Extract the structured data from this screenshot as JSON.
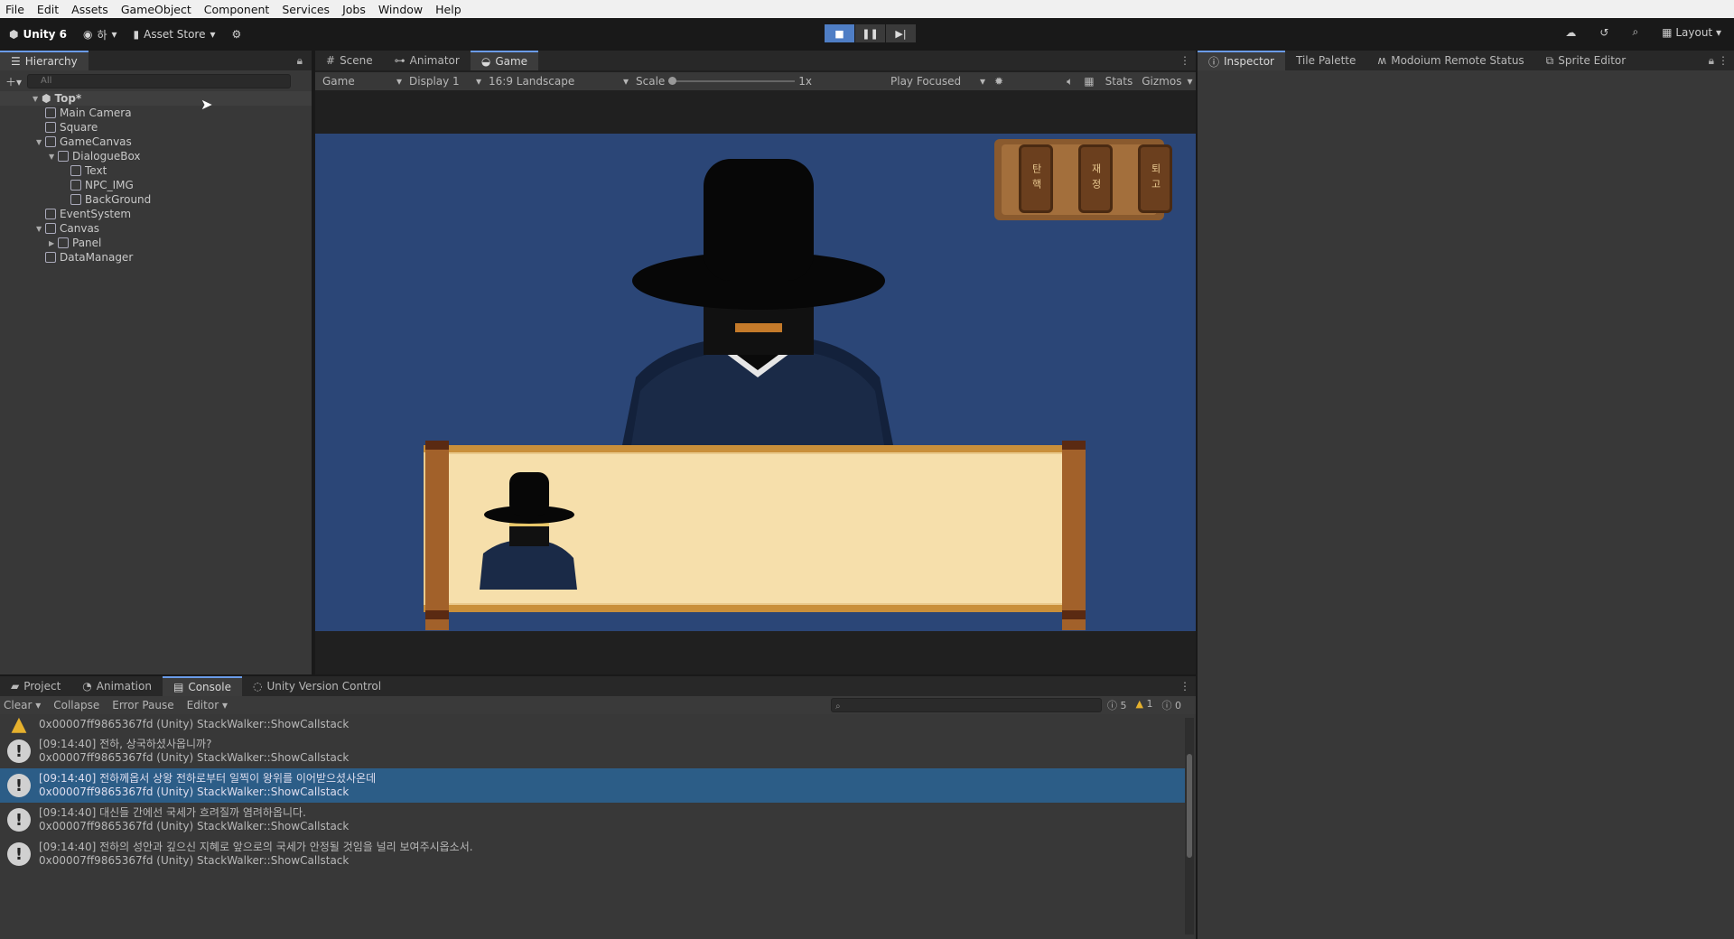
{
  "menu": [
    "File",
    "Edit",
    "Assets",
    "GameObject",
    "Component",
    "Services",
    "Jobs",
    "Window",
    "Help"
  ],
  "toolbar": {
    "unity_label": "Unity 6",
    "account_label": "하",
    "asset_store_label": "Asset Store",
    "layout_label": "Layout"
  },
  "hierarchy": {
    "tab_label": "Hierarchy",
    "search_placeholder": "All",
    "scene": "Top*",
    "items": [
      {
        "label": "Main Camera",
        "depth": 1,
        "expand": ""
      },
      {
        "label": "Square",
        "depth": 1,
        "expand": ""
      },
      {
        "label": "GameCanvas",
        "depth": 1,
        "expand": "▼"
      },
      {
        "label": "DialogueBox",
        "depth": 2,
        "expand": "▼"
      },
      {
        "label": "Text",
        "depth": 3,
        "expand": ""
      },
      {
        "label": "NPC_IMG",
        "depth": 3,
        "expand": ""
      },
      {
        "label": "BackGround",
        "depth": 3,
        "expand": ""
      },
      {
        "label": "EventSystem",
        "depth": 1,
        "expand": ""
      },
      {
        "label": "Canvas",
        "depth": 1,
        "expand": "▼"
      },
      {
        "label": "Panel",
        "depth": 2,
        "expand": "▶"
      },
      {
        "label": "DataManager",
        "depth": 1,
        "expand": ""
      }
    ]
  },
  "center_tabs": {
    "scene": "Scene",
    "animator": "Animator",
    "game": "Game"
  },
  "game_toolbar": {
    "mode": "Game",
    "display": "Display 1",
    "aspect": "16:9 Landscape",
    "scale_label": "Scale",
    "scale_value": "1x",
    "play_mode": "Play Focused",
    "stats": "Stats",
    "gizmos": "Gizmos"
  },
  "game_view": {
    "buttons": [
      "탄핵",
      "재정",
      "퇴고"
    ]
  },
  "right_tabs": {
    "inspector": "Inspector",
    "tile_palette": "Tile Palette",
    "modoium": "Modoium Remote Status",
    "sprite_editor": "Sprite Editor"
  },
  "bottom_tabs": {
    "project": "Project",
    "animation": "Animation",
    "console": "Console",
    "uvc": "Unity Version Control"
  },
  "console_toolbar": {
    "clear": "Clear",
    "collapse": "Collapse",
    "error_pause": "Error Pause",
    "editor": "Editor",
    "count_errors": "5",
    "count_warnings": "1",
    "count_info": "0"
  },
  "logs": [
    {
      "msg": "",
      "stack": "0x00007ff9865367fd (Unity) StackWalker::ShowCallstack",
      "type": "warn"
    },
    {
      "msg": "[09:14:40] 전하, 상국하셨사옵니까?",
      "stack": "0x00007ff9865367fd (Unity) StackWalker::ShowCallstack",
      "type": "info"
    },
    {
      "msg": "[09:14:40] 전하께옵서 상왕 전하로부터 일찍이 왕위를 이어받으셨사온데",
      "stack": "0x00007ff9865367fd (Unity) StackWalker::ShowCallstack",
      "type": "info"
    },
    {
      "msg": "[09:14:40] 대신들 간에선 국세가 흐려질까 염려하옵니다.",
      "stack": "0x00007ff9865367fd (Unity) StackWalker::ShowCallstack",
      "type": "info"
    },
    {
      "msg": "[09:14:40] 전하의 성안과 깊으신 지혜로 앞으로의 국세가 안정될 것임을 널리 보여주시옵소서.",
      "stack": "0x00007ff9865367fd (Unity) StackWalker::ShowCallstack",
      "type": "info"
    }
  ]
}
